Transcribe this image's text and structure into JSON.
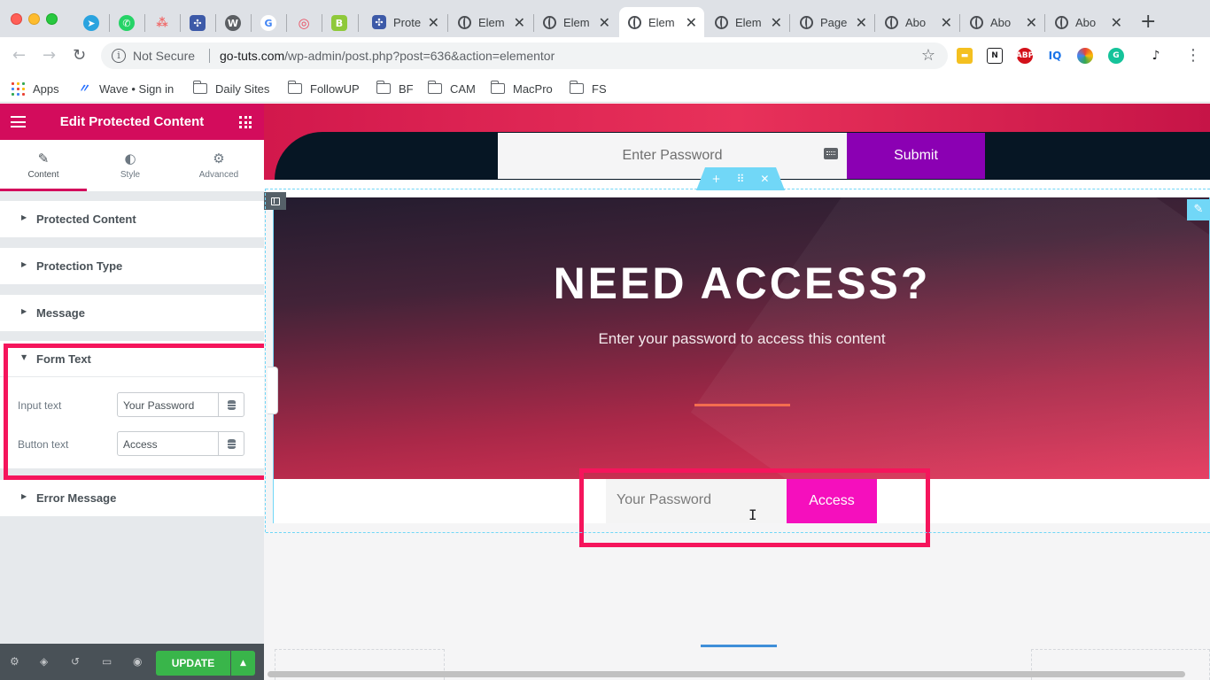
{
  "browser": {
    "tabs": [
      {
        "label": "Prote",
        "icon": "elementor-icon"
      },
      {
        "label": "Elem",
        "icon": "globe-icon"
      },
      {
        "label": "Elem",
        "icon": "globe-icon"
      },
      {
        "label": "Elem",
        "icon": "globe-icon",
        "active": true
      },
      {
        "label": "Elem",
        "icon": "globe-icon"
      },
      {
        "label": "Page",
        "icon": "globe-icon"
      },
      {
        "label": "Abo",
        "icon": "globe-icon"
      },
      {
        "label": "Abo",
        "icon": "globe-icon"
      },
      {
        "label": "Abo",
        "icon": "globe-icon"
      }
    ],
    "tab_close_glyph": "✕",
    "new_tab_glyph": "+",
    "security_label": "Not Secure",
    "url_host": "go-tuts.com",
    "url_path": "/wp-admin/post.php?post=636&action=elementor",
    "bookmarks": [
      "Apps",
      "Wave • Sign in",
      "Daily Sites",
      "FollowUP",
      "BF",
      "CAM",
      "MacPro",
      "FS"
    ]
  },
  "panel": {
    "title": "Edit Protected Content",
    "tabs": [
      {
        "label": "Content",
        "icon": "pencil-icon"
      },
      {
        "label": "Style",
        "icon": "half-circle-icon"
      },
      {
        "label": "Advanced",
        "icon": "gear-icon"
      }
    ],
    "sections": {
      "protected_content": "Protected Content",
      "protection_type": "Protection Type",
      "message": "Message",
      "form_text": "Form Text",
      "error_message": "Error Message"
    },
    "controls": {
      "input_text_label": "Input text",
      "input_text_value": "Your Password",
      "button_text_label": "Button text",
      "button_text_value": "Access"
    },
    "update_label": "UPDATE"
  },
  "preview": {
    "top_form": {
      "placeholder": "Enter Password",
      "button": "Submit"
    },
    "hero_title": "NEED ACCESS?",
    "hero_subtitle": "Enter your password to access this content",
    "access_form": {
      "placeholder": "Your Password",
      "button": "Access"
    }
  },
  "colors": {
    "elementor_brand": "#d30c5c",
    "highlight": "#f5155c",
    "submit_button": "#8b00b3",
    "access_button": "#f50fbd",
    "update_button": "#39b54a"
  }
}
